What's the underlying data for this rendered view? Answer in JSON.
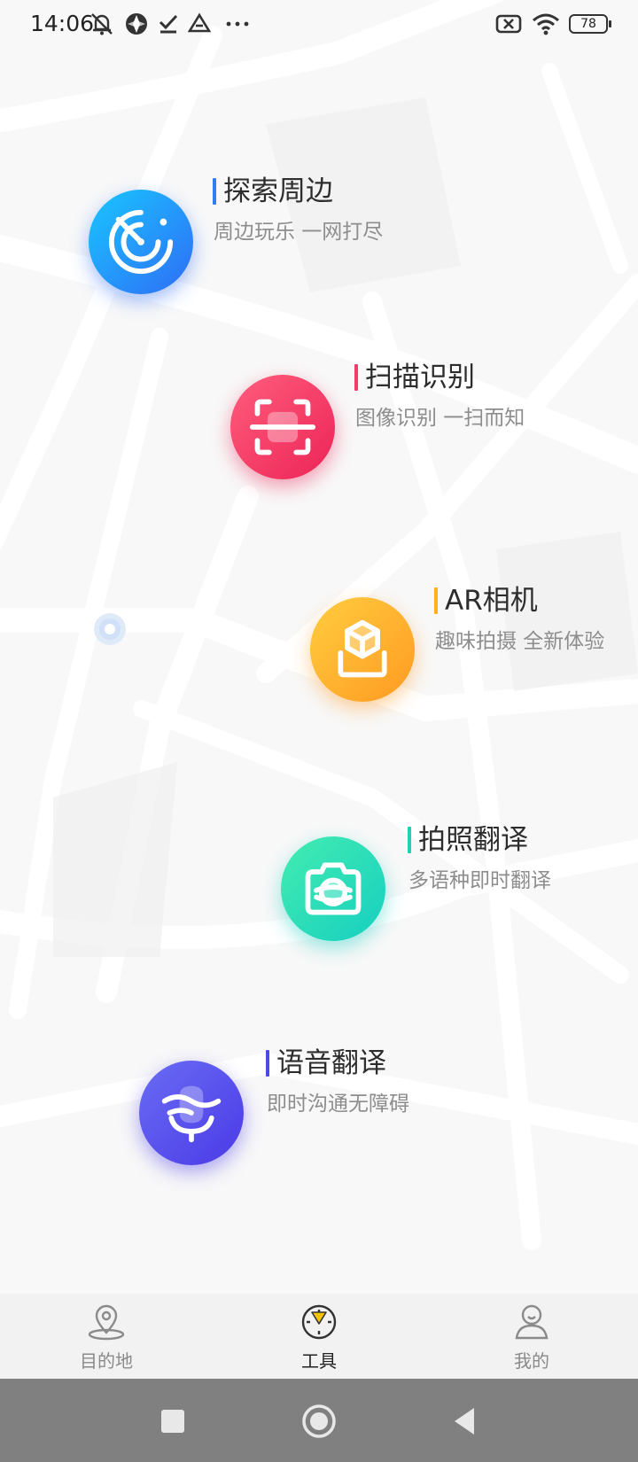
{
  "status_bar": {
    "time": "14:06",
    "left_icons": [
      "notifications-off-icon",
      "app-badge-icon",
      "checkmark-icon",
      "drive-icon",
      "more-dots-icon"
    ],
    "right_icons": [
      "sim-off-icon",
      "wifi-icon",
      "battery-icon"
    ],
    "battery_level": "78"
  },
  "tools": [
    {
      "title": "探索周边",
      "subtitle": "周边玩乐 一网打尽",
      "icon": "radar-icon",
      "colors": [
        "#19c6ff",
        "#2f6df6"
      ],
      "bar_color": "#2f7ef5"
    },
    {
      "title": "扫描识别",
      "subtitle": "图像识别 一扫而知",
      "icon": "scan-icon",
      "colors": [
        "#ff5d7c",
        "#ec2457"
      ],
      "bar_color": "#f03e6a"
    },
    {
      "title": "AR相机",
      "subtitle": "趣味拍摄 全新体验",
      "icon": "ar-box-icon",
      "colors": [
        "#ffcd3f",
        "#ff9a22"
      ],
      "bar_color": "#ffb21e"
    },
    {
      "title": "拍照翻译",
      "subtitle": "多语种即时翻译",
      "icon": "camera-translate-icon",
      "colors": [
        "#43ecb0",
        "#16cfc0"
      ],
      "bar_color": "#1fd2b6"
    },
    {
      "title": "语音翻译",
      "subtitle": "即时沟通无障碍",
      "icon": "voice-translate-icon",
      "colors": [
        "#6a6cf4",
        "#4a3ae6"
      ],
      "bar_color": "#4f49e8"
    }
  ],
  "tabbar": {
    "tabs": [
      {
        "label": "目的地",
        "icon": "location-pin-icon",
        "active": false
      },
      {
        "label": "工具",
        "icon": "compass-icon",
        "active": true
      },
      {
        "label": "我的",
        "icon": "user-icon",
        "active": false
      }
    ]
  },
  "system_nav": [
    "recent-apps-icon",
    "home-icon",
    "back-icon"
  ]
}
